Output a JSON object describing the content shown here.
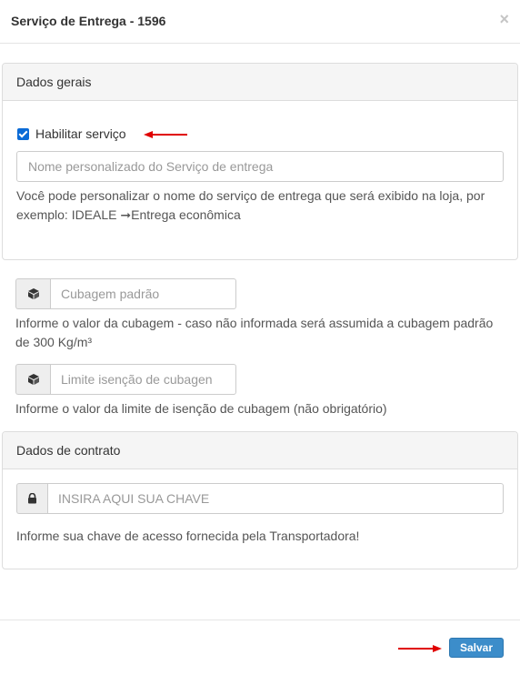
{
  "modal": {
    "title": "Serviço de Entrega - 1596",
    "close_symbol": "×"
  },
  "general_panel": {
    "heading": "Dados gerais",
    "enable_checkbox": {
      "label": "Habilitar serviço",
      "checked": true
    },
    "custom_name": {
      "placeholder": "Nome personalizado do Serviço de entrega",
      "value": ""
    },
    "help_line1": "Você pode personalizar o nome do serviço de entrega que será exibido na loja, por",
    "help_line2": "exemplo: IDEALE ➞Entrega econômica"
  },
  "cubagem": {
    "icon": "cube-icon",
    "placeholder": "Cubagem padrão",
    "help_line1": "Informe o valor da cubagem - caso não informada será assumida a cubagem padrão",
    "help_line2": "de 300 Kg/m³"
  },
  "isencao": {
    "icon": "cube-icon",
    "placeholder": "Limite isenção de cubagen",
    "help": "Informe o valor da limite de isenção de cubagem (não obrigatório)"
  },
  "contract_panel": {
    "heading": "Dados de contrato",
    "key_icon": "lock-icon",
    "key_placeholder": "INSIRA AQUI SUA CHAVE",
    "help": "Informe sua chave de acesso fornecida pela Transportadora!"
  },
  "footer": {
    "save_label": "Salvar"
  },
  "colors": {
    "checkbox": "#0b6bd6",
    "save_button": "#3c8dca",
    "annotation_arrow": "#e00000"
  }
}
